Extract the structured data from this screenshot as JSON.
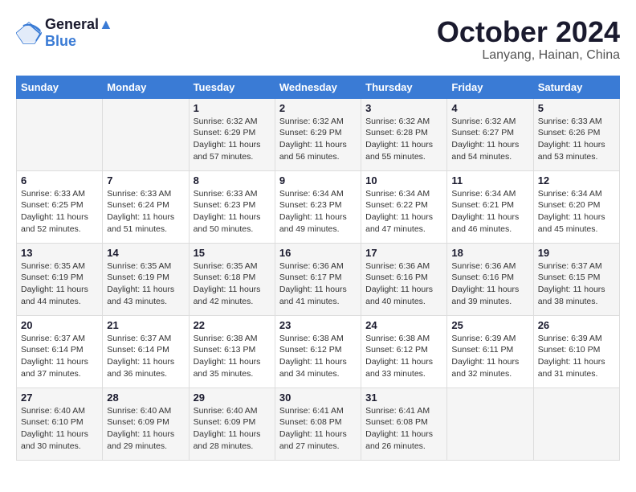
{
  "header": {
    "logo_line1": "General",
    "logo_line2": "Blue",
    "month_title": "October 2024",
    "location": "Lanyang, Hainan, China"
  },
  "days_of_week": [
    "Sunday",
    "Monday",
    "Tuesday",
    "Wednesday",
    "Thursday",
    "Friday",
    "Saturday"
  ],
  "weeks": [
    [
      {
        "day": "",
        "sunrise": "",
        "sunset": "",
        "daylight": ""
      },
      {
        "day": "",
        "sunrise": "",
        "sunset": "",
        "daylight": ""
      },
      {
        "day": "1",
        "sunrise": "Sunrise: 6:32 AM",
        "sunset": "Sunset: 6:29 PM",
        "daylight": "Daylight: 11 hours and 57 minutes."
      },
      {
        "day": "2",
        "sunrise": "Sunrise: 6:32 AM",
        "sunset": "Sunset: 6:29 PM",
        "daylight": "Daylight: 11 hours and 56 minutes."
      },
      {
        "day": "3",
        "sunrise": "Sunrise: 6:32 AM",
        "sunset": "Sunset: 6:28 PM",
        "daylight": "Daylight: 11 hours and 55 minutes."
      },
      {
        "day": "4",
        "sunrise": "Sunrise: 6:32 AM",
        "sunset": "Sunset: 6:27 PM",
        "daylight": "Daylight: 11 hours and 54 minutes."
      },
      {
        "day": "5",
        "sunrise": "Sunrise: 6:33 AM",
        "sunset": "Sunset: 6:26 PM",
        "daylight": "Daylight: 11 hours and 53 minutes."
      }
    ],
    [
      {
        "day": "6",
        "sunrise": "Sunrise: 6:33 AM",
        "sunset": "Sunset: 6:25 PM",
        "daylight": "Daylight: 11 hours and 52 minutes."
      },
      {
        "day": "7",
        "sunrise": "Sunrise: 6:33 AM",
        "sunset": "Sunset: 6:24 PM",
        "daylight": "Daylight: 11 hours and 51 minutes."
      },
      {
        "day": "8",
        "sunrise": "Sunrise: 6:33 AM",
        "sunset": "Sunset: 6:23 PM",
        "daylight": "Daylight: 11 hours and 50 minutes."
      },
      {
        "day": "9",
        "sunrise": "Sunrise: 6:34 AM",
        "sunset": "Sunset: 6:23 PM",
        "daylight": "Daylight: 11 hours and 49 minutes."
      },
      {
        "day": "10",
        "sunrise": "Sunrise: 6:34 AM",
        "sunset": "Sunset: 6:22 PM",
        "daylight": "Daylight: 11 hours and 47 minutes."
      },
      {
        "day": "11",
        "sunrise": "Sunrise: 6:34 AM",
        "sunset": "Sunset: 6:21 PM",
        "daylight": "Daylight: 11 hours and 46 minutes."
      },
      {
        "day": "12",
        "sunrise": "Sunrise: 6:34 AM",
        "sunset": "Sunset: 6:20 PM",
        "daylight": "Daylight: 11 hours and 45 minutes."
      }
    ],
    [
      {
        "day": "13",
        "sunrise": "Sunrise: 6:35 AM",
        "sunset": "Sunset: 6:19 PM",
        "daylight": "Daylight: 11 hours and 44 minutes."
      },
      {
        "day": "14",
        "sunrise": "Sunrise: 6:35 AM",
        "sunset": "Sunset: 6:19 PM",
        "daylight": "Daylight: 11 hours and 43 minutes."
      },
      {
        "day": "15",
        "sunrise": "Sunrise: 6:35 AM",
        "sunset": "Sunset: 6:18 PM",
        "daylight": "Daylight: 11 hours and 42 minutes."
      },
      {
        "day": "16",
        "sunrise": "Sunrise: 6:36 AM",
        "sunset": "Sunset: 6:17 PM",
        "daylight": "Daylight: 11 hours and 41 minutes."
      },
      {
        "day": "17",
        "sunrise": "Sunrise: 6:36 AM",
        "sunset": "Sunset: 6:16 PM",
        "daylight": "Daylight: 11 hours and 40 minutes."
      },
      {
        "day": "18",
        "sunrise": "Sunrise: 6:36 AM",
        "sunset": "Sunset: 6:16 PM",
        "daylight": "Daylight: 11 hours and 39 minutes."
      },
      {
        "day": "19",
        "sunrise": "Sunrise: 6:37 AM",
        "sunset": "Sunset: 6:15 PM",
        "daylight": "Daylight: 11 hours and 38 minutes."
      }
    ],
    [
      {
        "day": "20",
        "sunrise": "Sunrise: 6:37 AM",
        "sunset": "Sunset: 6:14 PM",
        "daylight": "Daylight: 11 hours and 37 minutes."
      },
      {
        "day": "21",
        "sunrise": "Sunrise: 6:37 AM",
        "sunset": "Sunset: 6:14 PM",
        "daylight": "Daylight: 11 hours and 36 minutes."
      },
      {
        "day": "22",
        "sunrise": "Sunrise: 6:38 AM",
        "sunset": "Sunset: 6:13 PM",
        "daylight": "Daylight: 11 hours and 35 minutes."
      },
      {
        "day": "23",
        "sunrise": "Sunrise: 6:38 AM",
        "sunset": "Sunset: 6:12 PM",
        "daylight": "Daylight: 11 hours and 34 minutes."
      },
      {
        "day": "24",
        "sunrise": "Sunrise: 6:38 AM",
        "sunset": "Sunset: 6:12 PM",
        "daylight": "Daylight: 11 hours and 33 minutes."
      },
      {
        "day": "25",
        "sunrise": "Sunrise: 6:39 AM",
        "sunset": "Sunset: 6:11 PM",
        "daylight": "Daylight: 11 hours and 32 minutes."
      },
      {
        "day": "26",
        "sunrise": "Sunrise: 6:39 AM",
        "sunset": "Sunset: 6:10 PM",
        "daylight": "Daylight: 11 hours and 31 minutes."
      }
    ],
    [
      {
        "day": "27",
        "sunrise": "Sunrise: 6:40 AM",
        "sunset": "Sunset: 6:10 PM",
        "daylight": "Daylight: 11 hours and 30 minutes."
      },
      {
        "day": "28",
        "sunrise": "Sunrise: 6:40 AM",
        "sunset": "Sunset: 6:09 PM",
        "daylight": "Daylight: 11 hours and 29 minutes."
      },
      {
        "day": "29",
        "sunrise": "Sunrise: 6:40 AM",
        "sunset": "Sunset: 6:09 PM",
        "daylight": "Daylight: 11 hours and 28 minutes."
      },
      {
        "day": "30",
        "sunrise": "Sunrise: 6:41 AM",
        "sunset": "Sunset: 6:08 PM",
        "daylight": "Daylight: 11 hours and 27 minutes."
      },
      {
        "day": "31",
        "sunrise": "Sunrise: 6:41 AM",
        "sunset": "Sunset: 6:08 PM",
        "daylight": "Daylight: 11 hours and 26 minutes."
      },
      {
        "day": "",
        "sunrise": "",
        "sunset": "",
        "daylight": ""
      },
      {
        "day": "",
        "sunrise": "",
        "sunset": "",
        "daylight": ""
      }
    ]
  ]
}
